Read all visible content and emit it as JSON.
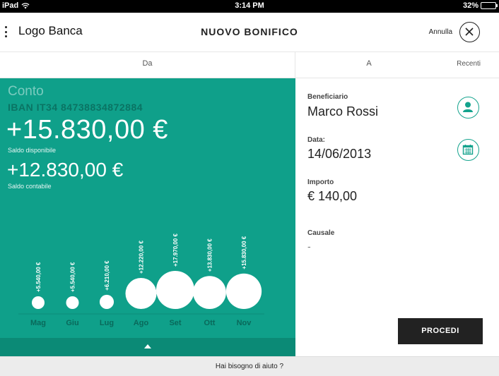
{
  "status_bar": {
    "carrier": "iPad",
    "time": "3:14 PM",
    "battery": "32%",
    "battery_level": 0.32
  },
  "header": {
    "logo": "Logo Banca",
    "title": "NUOVO BONIFICO",
    "cancel_label": "Annulla"
  },
  "tabs": {
    "from": "Da",
    "to": "A",
    "recent": "Recenti"
  },
  "account": {
    "name": "Conto",
    "iban": "IBAN IT34 84738834872884",
    "available_balance": "+15.830,00 €",
    "available_label": "Saldo disponibile",
    "accounting_balance": "+12.830,00 €",
    "accounting_label": "Saldo contabile"
  },
  "chart_data": {
    "type": "bubble",
    "categories": [
      "Mag",
      "Giu",
      "Lug",
      "Ago",
      "Set",
      "Ott",
      "Nov"
    ],
    "values": [
      5540,
      5540,
      6210,
      12220,
      17970,
      13830,
      15830
    ],
    "labels": [
      "+5.540,00 €",
      "+5.540,00 €",
      "+6.210,00 €",
      "+12.220,00 €",
      "+17.970,00 €",
      "+13.830,00 €",
      "+15.830,00 €"
    ],
    "title": "",
    "xlabel": "",
    "ylabel": "",
    "grid": false
  },
  "form": {
    "beneficiary_label": "Beneficiario",
    "beneficiary_value": "Marco Rossi",
    "date_label": "Data:",
    "date_value": "14/06/2013",
    "amount_label": "Importo",
    "amount_value": "€ 140,00",
    "reason_label": "Causale",
    "reason_value": "-",
    "submit_label": "PROCEDI"
  },
  "footer": {
    "help": "Hai bisogno di aiuto ?"
  },
  "colors": {
    "accent": "#0fa08a",
    "accent_dark": "#0b8a76",
    "button": "#222222"
  }
}
